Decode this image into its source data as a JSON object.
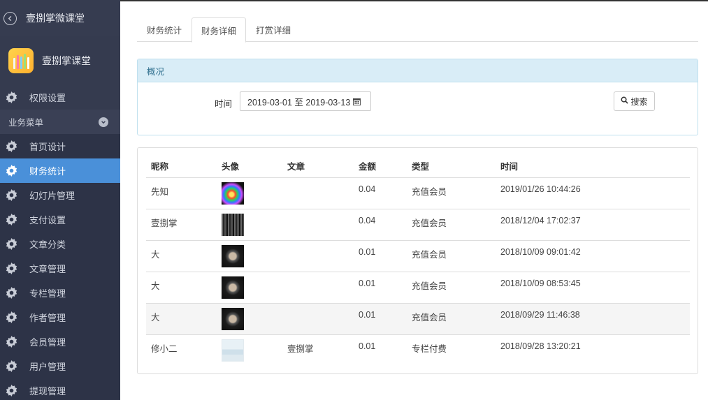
{
  "sidebar": {
    "top_title": "壹捌掌微课堂",
    "brand_name": "壹捌掌课堂",
    "permissions_label": "权限设置",
    "group_label": "业务菜单",
    "items": [
      {
        "label": "首页设计"
      },
      {
        "label": "财务统计"
      },
      {
        "label": "幻灯片管理"
      },
      {
        "label": "支付设置"
      },
      {
        "label": "文章分类"
      },
      {
        "label": "文章管理"
      },
      {
        "label": "专栏管理"
      },
      {
        "label": "作者管理"
      },
      {
        "label": "会员管理"
      },
      {
        "label": "用户管理"
      },
      {
        "label": "提现管理"
      }
    ],
    "active_index": 1
  },
  "tabs": [
    {
      "label": "财务统计"
    },
    {
      "label": "财务详细"
    },
    {
      "label": "打赏详细"
    }
  ],
  "overview": {
    "title": "概况",
    "time_label": "时间",
    "date_range": "2019-03-01 至 2019-03-13",
    "search_label": "搜索"
  },
  "table": {
    "headers": [
      "昵称",
      "头像",
      "文章",
      "金额",
      "类型",
      "时间"
    ],
    "rows": [
      {
        "nickname": "先知",
        "avatar": "rainbow",
        "article": "",
        "amount": "0.04",
        "type": "充值会员",
        "time": "2019/01/26 10:44:26"
      },
      {
        "nickname": "壹捌掌",
        "avatar": "grid",
        "article": "",
        "amount": "0.04",
        "type": "充值会员",
        "time": "2018/12/04 17:02:37"
      },
      {
        "nickname": "大",
        "avatar": "dark",
        "article": "",
        "amount": "0.01",
        "type": "充值会员",
        "time": "2018/10/09 09:01:42"
      },
      {
        "nickname": "大",
        "avatar": "dark",
        "article": "",
        "amount": "0.01",
        "type": "充值会员",
        "time": "2018/10/09 08:53:45"
      },
      {
        "nickname": "大",
        "avatar": "dark",
        "article": "",
        "amount": "0.01",
        "type": "充值会员",
        "time": "2018/09/29 11:46:38"
      },
      {
        "nickname": "修小二",
        "avatar": "light",
        "article": "壹捌掌",
        "amount": "0.01",
        "type": "专栏付费",
        "time": "2018/09/28 13:20:21"
      }
    ]
  },
  "colors": {
    "sidebar_bg": "#2d3347",
    "active_item": "#4a90d9",
    "panel_head": "#d9edf7"
  }
}
